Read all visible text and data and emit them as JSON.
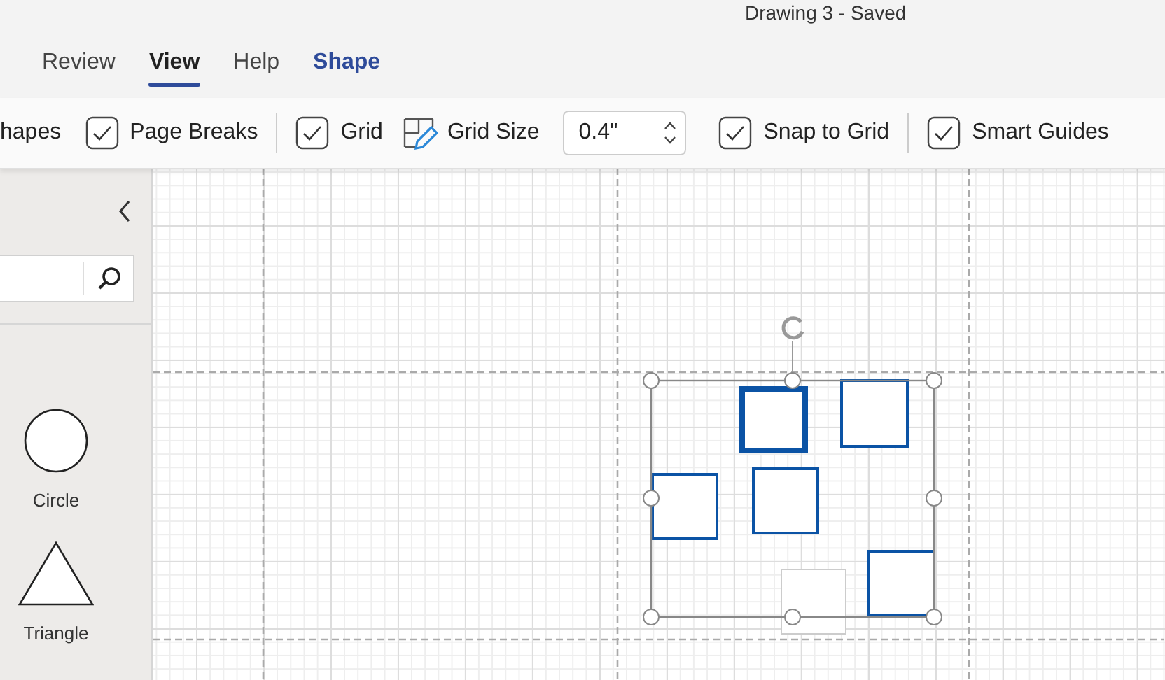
{
  "window": {
    "title": "Drawing 3 - Saved"
  },
  "tabs": [
    {
      "label": "Review",
      "selected": false,
      "kind": "normal"
    },
    {
      "label": "View",
      "selected": true,
      "kind": "normal"
    },
    {
      "label": "Help",
      "selected": false,
      "kind": "normal"
    },
    {
      "label": "Shape",
      "selected": false,
      "kind": "contextual"
    }
  ],
  "toolbar": [
    {
      "kind": "label",
      "label": "hapes"
    },
    {
      "kind": "checkbox",
      "label": "Page Breaks",
      "checked": true
    },
    {
      "kind": "separator"
    },
    {
      "kind": "checkbox",
      "label": "Grid",
      "checked": true
    },
    {
      "kind": "button",
      "label": "Grid Size"
    },
    {
      "kind": "spinner",
      "value": "0.4\""
    },
    {
      "kind": "checkbox",
      "label": "Snap to Grid",
      "checked": true
    },
    {
      "kind": "separator"
    },
    {
      "kind": "checkbox",
      "label": "Smart Guides",
      "checked": true
    }
  ],
  "sidebar": {
    "shapes": [
      {
        "kind": "circle",
        "label": "Circle"
      },
      {
        "kind": "triangle",
        "label": "Triangle"
      }
    ]
  }
}
